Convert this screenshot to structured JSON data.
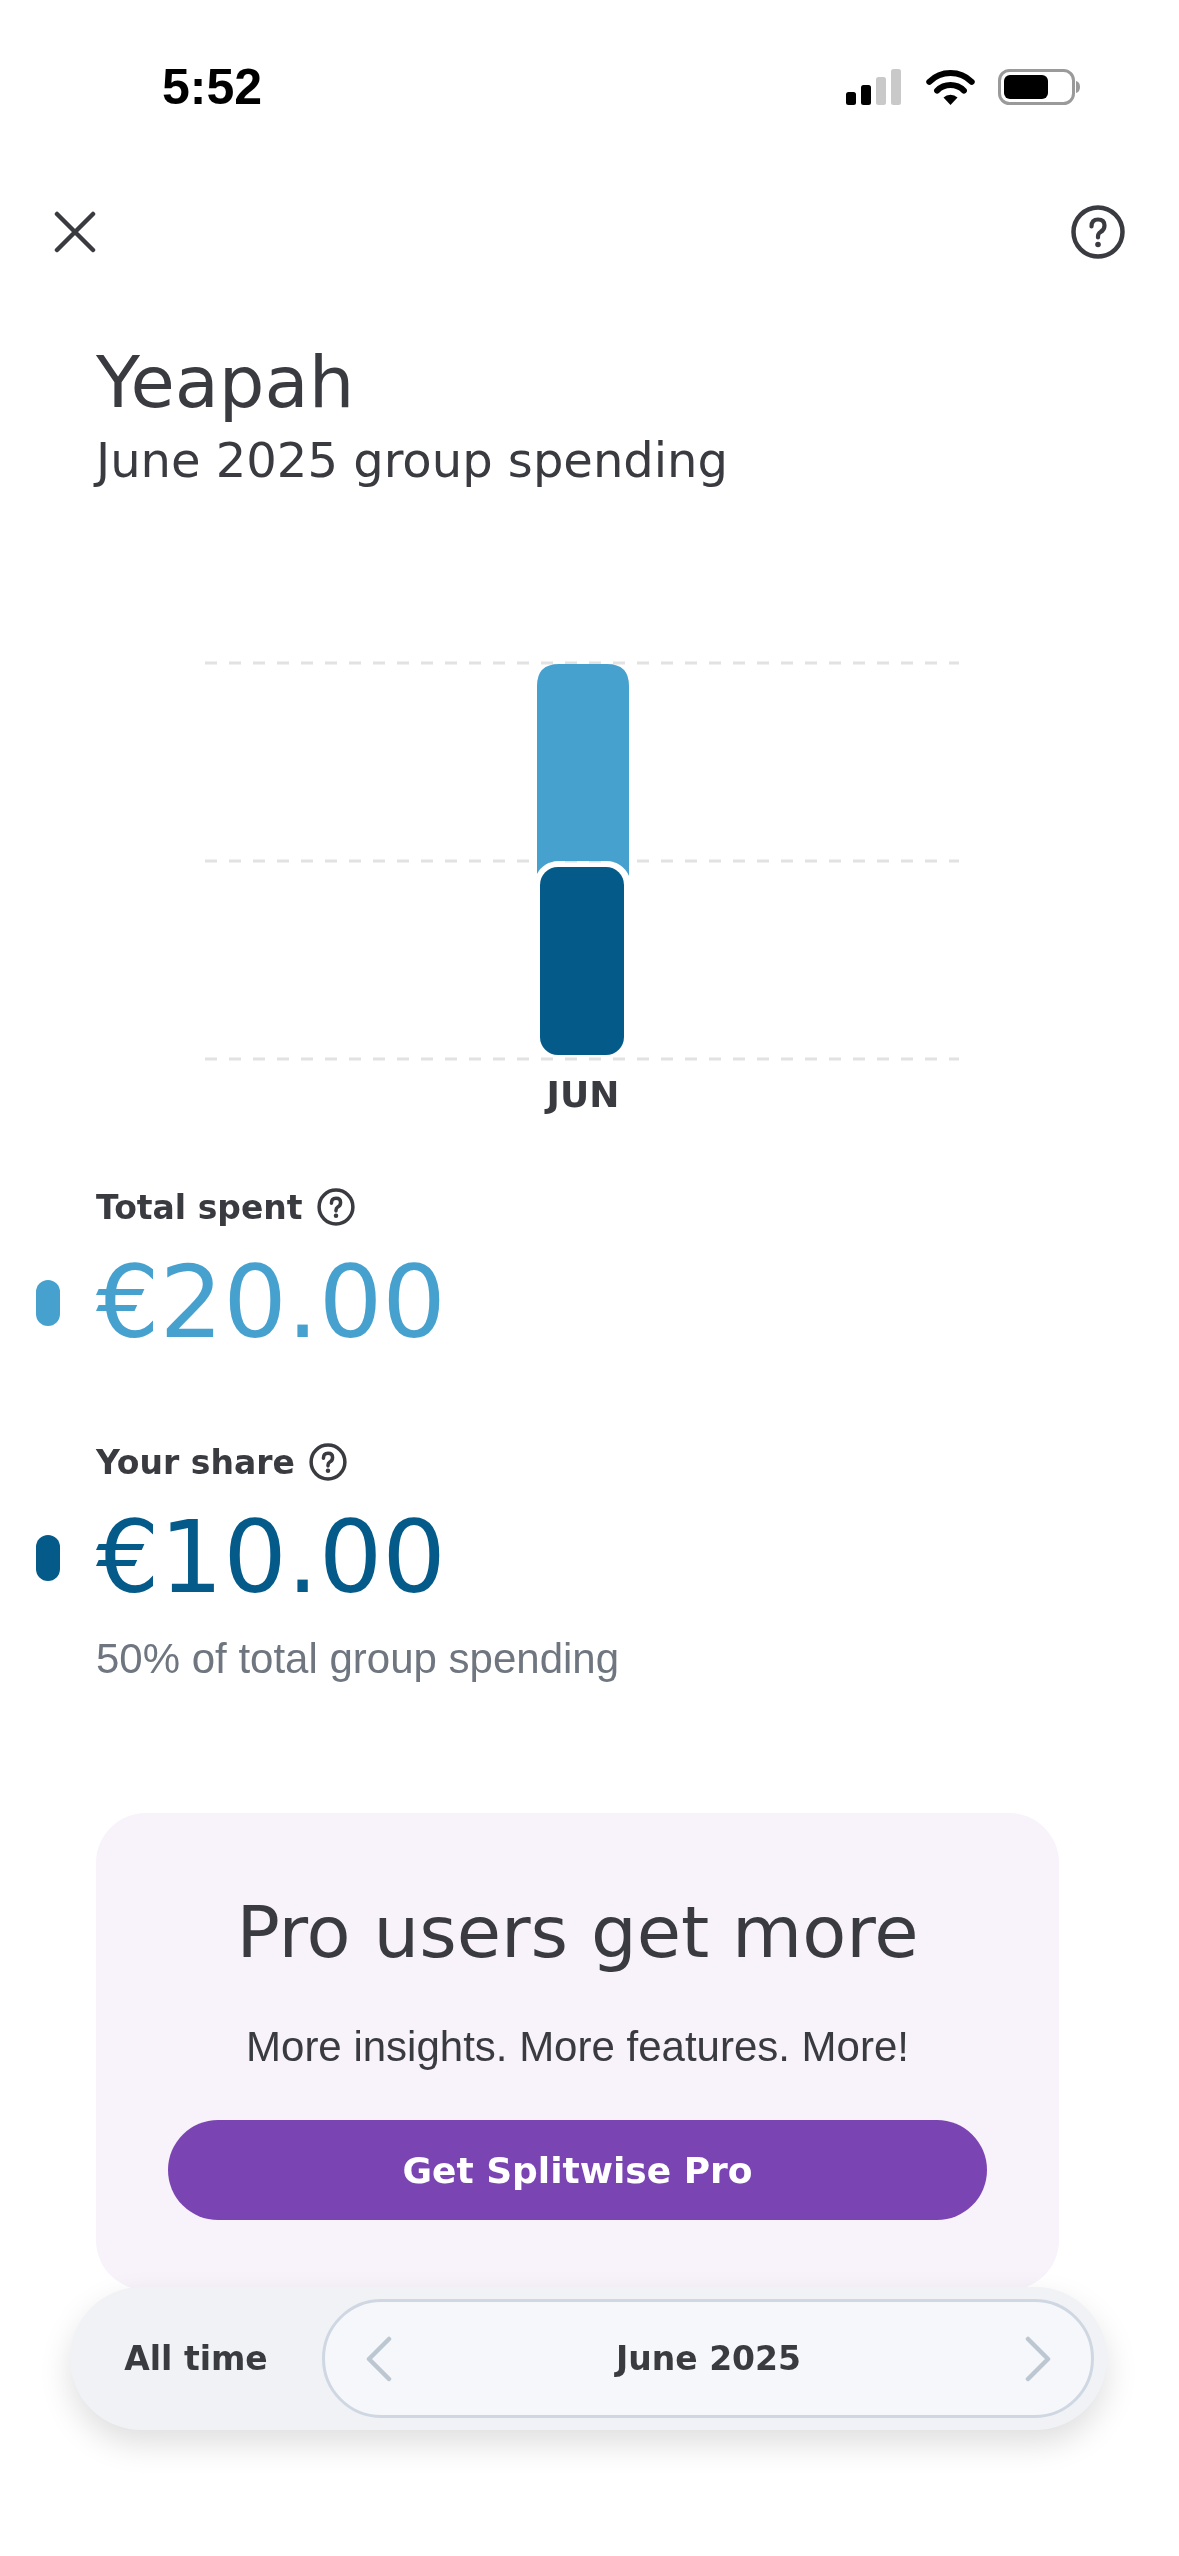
{
  "status_bar": {
    "time": "5:52"
  },
  "header": {
    "title": "Yeapah",
    "subtitle": "June 2025 group spending"
  },
  "chart": {
    "category": "JUN"
  },
  "totals": [
    {
      "label": "Total spent",
      "amount": "€20.00",
      "color": "#47a1cf"
    },
    {
      "label": "Your share",
      "amount": "€10.00",
      "color": "#045b8a",
      "note": "50% of total group spending"
    }
  ],
  "promo": {
    "title": "Pro users get more",
    "text": "More insights. More features. More!",
    "button": "Get Splitwise Pro"
  },
  "period_bar": {
    "options": [
      {
        "label": "All time",
        "kind": "preset",
        "selected": false
      },
      {
        "label": "June 2025",
        "kind": "month",
        "selected": true
      }
    ]
  }
}
